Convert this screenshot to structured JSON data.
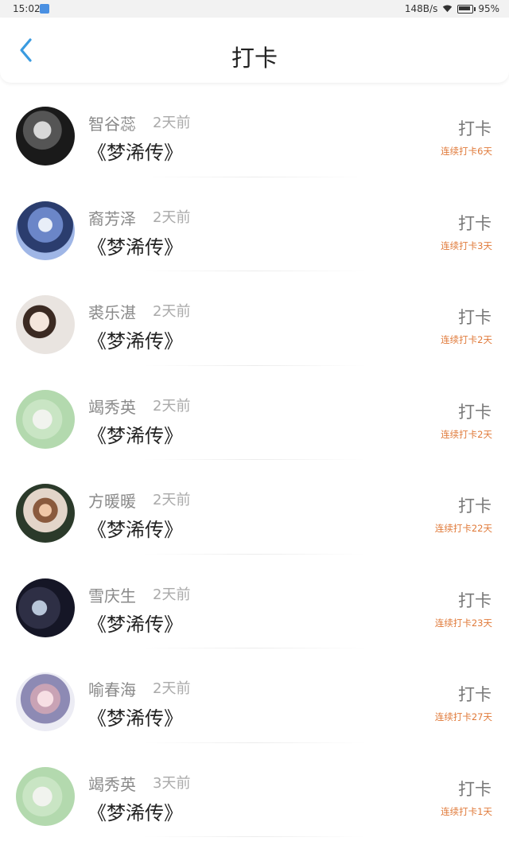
{
  "status_bar": {
    "time": "15:02",
    "network_speed": "148B/s",
    "battery": "95%"
  },
  "header": {
    "title": "打卡",
    "accent_color": "#3a9be0"
  },
  "entries": [
    {
      "name": "智谷蕊",
      "time": "2天前",
      "book": "《梦浠传》",
      "action": "打卡",
      "streak": "连续打卡6天",
      "avatar": "avatar-bw"
    },
    {
      "name": "裔芳泽",
      "time": "2天前",
      "book": "《梦浠传》",
      "action": "打卡",
      "streak": "连续打卡3天",
      "avatar": "avatar-blue"
    },
    {
      "name": "裘乐湛",
      "time": "2天前",
      "book": "《梦浠传》",
      "action": "打卡",
      "streak": "连续打卡2天",
      "avatar": "avatar-light"
    },
    {
      "name": "竭秀英",
      "time": "2天前",
      "book": "《梦浠传》",
      "action": "打卡",
      "streak": "连续打卡2天",
      "avatar": "avatar-green"
    },
    {
      "name": "方暖暖",
      "time": "2天前",
      "book": "《梦浠传》",
      "action": "打卡",
      "streak": "连续打卡22天",
      "avatar": "avatar-warm"
    },
    {
      "name": "雪庆生",
      "time": "2天前",
      "book": "《梦浠传》",
      "action": "打卡",
      "streak": "连续打卡23天",
      "avatar": "avatar-dark"
    },
    {
      "name": "喻春海",
      "time": "2天前",
      "book": "《梦浠传》",
      "action": "打卡",
      "streak": "连续打卡27天",
      "avatar": "avatar-pastel"
    },
    {
      "name": "竭秀英",
      "time": "3天前",
      "book": "《梦浠传》",
      "action": "打卡",
      "streak": "连续打卡1天",
      "avatar": "avatar-green"
    }
  ]
}
